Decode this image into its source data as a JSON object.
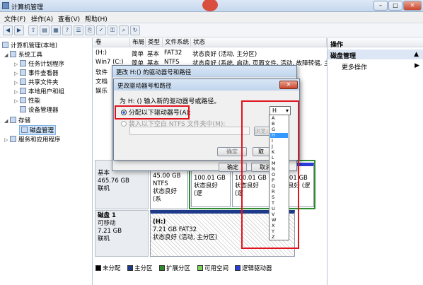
{
  "window": {
    "title": "计算机管理"
  },
  "menu": [
    "文件(F)",
    "操作(A)",
    "查看(V)",
    "帮助(H)"
  ],
  "tree": {
    "root": "计算机管理(本地)",
    "system_tools": "系统工具",
    "items": [
      "任务计划程序",
      "事件查看器",
      "共享文件夹",
      "本地用户和组",
      "性能",
      "设备管理器"
    ],
    "storage": "存储",
    "disk_mgmt": "磁盘管理",
    "services": "服务和应用程序"
  },
  "table": {
    "headers": [
      "卷",
      "布局",
      "类型",
      "文件系统",
      "状态"
    ],
    "rows": [
      [
        "(H:)",
        "简单",
        "基本",
        "FAT32",
        "状态良好 (活动, 主分区)"
      ],
      [
        "Win7 (C:)",
        "简单",
        "基本",
        "NTFS",
        "状态良好 (系统, 启动, 页面文件, 活动, 故障转储, 主"
      ],
      [
        "软件",
        "",
        "",
        "",
        ""
      ],
      [
        "文档",
        "",
        "",
        "",
        ""
      ],
      [
        "娱乐",
        "",
        "",
        "",
        ""
      ]
    ]
  },
  "disk0": {
    "line1": "基本",
    "size": "465.76 GB",
    "status": "联机"
  },
  "disk0_parts": [
    {
      "size": "45.00 GB NTFS",
      "status": "状态良好 (系"
    },
    {
      "size": "100.01 GB",
      "status": "状态良好 (逻"
    },
    {
      "size": "100.01 GB",
      "status": "状态良好 (逻"
    },
    {
      "size": "100.01 GB",
      "status": "状态良好 (逻"
    }
  ],
  "disk1": {
    "name": "磁盘 1",
    "type": "可移动",
    "size": "7.21 GB",
    "status": "联机"
  },
  "disk1_part": {
    "name": "(H:)",
    "size": "7.21 GB FAT32",
    "status": "状态良好 (活动, 主分区)"
  },
  "legend": [
    {
      "label": "未分配",
      "color": "#000000"
    },
    {
      "label": "主分区",
      "color": "#1d3a8a"
    },
    {
      "label": "扩展分区",
      "color": "#2e8b2e"
    },
    {
      "label": "可用空间",
      "color": "#7bd35a"
    },
    {
      "label": "逻辑驱动器",
      "color": "#2a3dd6"
    }
  ],
  "ops": {
    "header": "操作",
    "section": "磁盘管理",
    "more": "更多操作"
  },
  "dialog_outer": {
    "title": "更改 H:() 的驱动器号和路径",
    "ok": "确定",
    "cancel": "取消"
  },
  "dialog_inner": {
    "title": "更改驱动器号和路径",
    "prompt": "为 H: () 输入新的驱动器号或路径。",
    "opt1": "分配以下驱动器号(A):",
    "opt2": "装入以下空白 NTFS 文件夹中(M):",
    "browse": "浏览(R)...",
    "ok": "确定",
    "cancel": "取",
    "selected_letter": "H"
  },
  "letters": [
    "A",
    "B",
    "G",
    "H",
    "I",
    "J",
    "K",
    "L",
    "M",
    "N",
    "O",
    "P",
    "Q",
    "R",
    "S",
    "T",
    "U",
    "V",
    "W",
    "X",
    "Y",
    "Z"
  ],
  "accent": {
    "red_highlight": "#e0141e",
    "selection_blue": "#3399ff"
  }
}
